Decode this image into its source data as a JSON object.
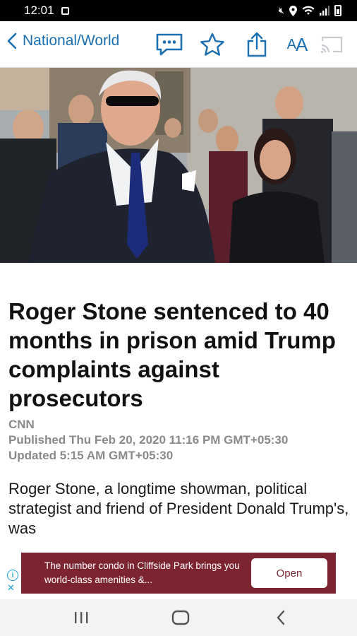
{
  "status_bar": {
    "time": "12:01"
  },
  "toolbar": {
    "back_label": "National/World",
    "font_size_label_large": "A",
    "font_size_label_small": "A"
  },
  "article": {
    "headline": "Roger Stone sentenced to 40 months in prison amid Trump complaints against prosecutors",
    "source": "CNN",
    "published": "Published Thu Feb 20, 2020 11:16 PM GMT+05:30",
    "updated": "Updated 5:15 AM GMT+05:30",
    "body": "Roger Stone, a longtime showman, political strategist and friend of President Donald Trump's, was"
  },
  "ad": {
    "text": "The number condo in Cliffside Park brings you world-class amenities &...",
    "button_label": "Open",
    "background": "#7c2430"
  },
  "colors": {
    "accent": "#1a6fb2",
    "meta_gray": "#8a8a8a"
  }
}
